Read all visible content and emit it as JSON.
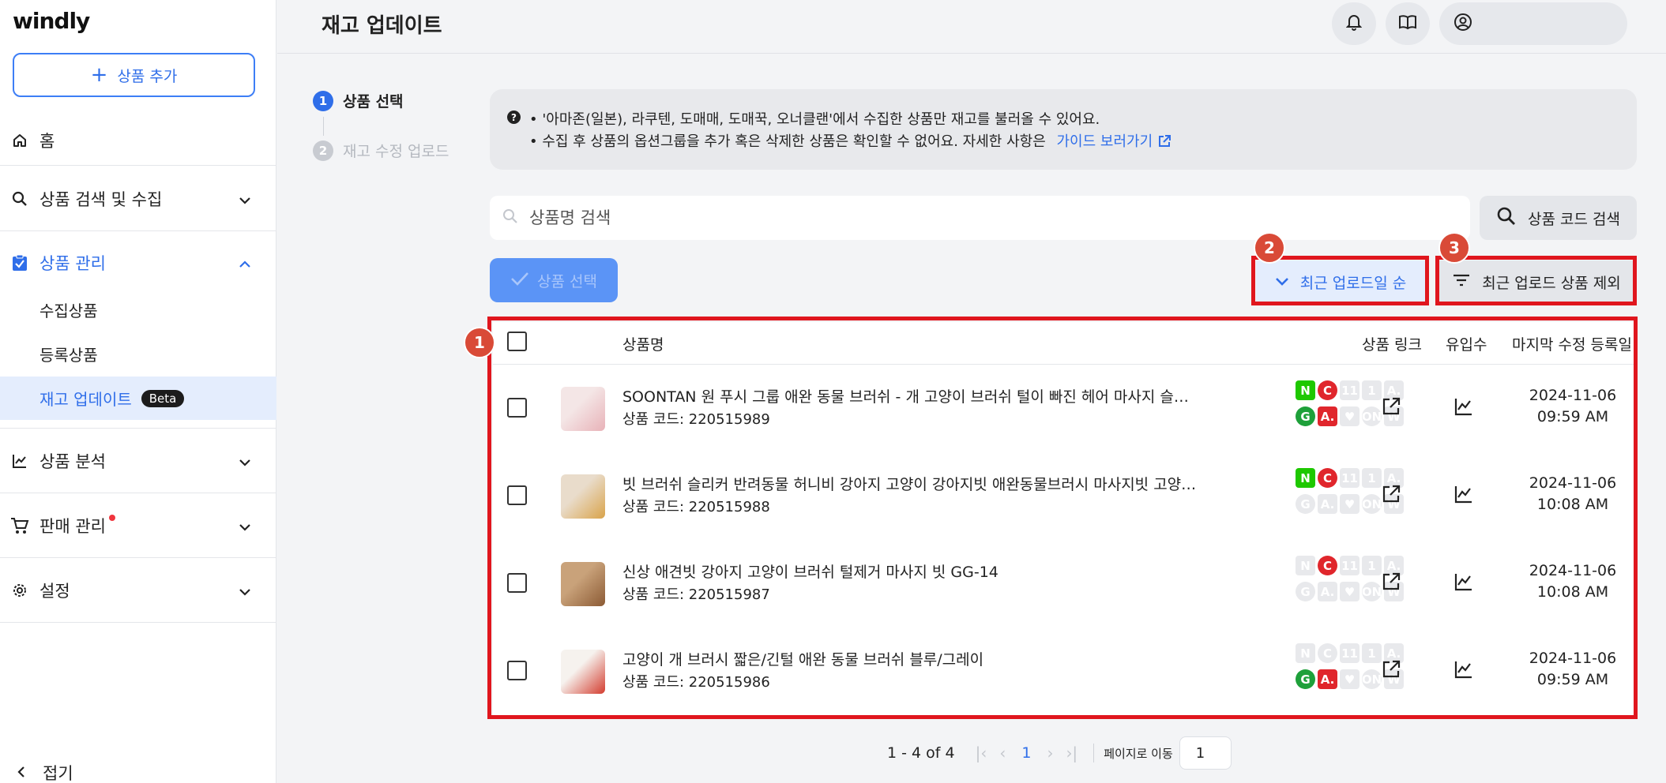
{
  "app": {
    "logo": "windly"
  },
  "sidebar": {
    "add_button": "상품 추가",
    "items": [
      {
        "label": "홈"
      },
      {
        "label": "상품 검색 및 수집"
      },
      {
        "label": "상품 관리"
      },
      {
        "label": "상품 분석"
      },
      {
        "label": "판매 관리"
      },
      {
        "label": "설정"
      }
    ],
    "sub_items": [
      {
        "label": "수집상품"
      },
      {
        "label": "등록상품"
      },
      {
        "label": "재고 업데이트",
        "badge": "Beta"
      }
    ],
    "collapse": "접기"
  },
  "header": {
    "title": "재고 업데이트"
  },
  "steps": [
    {
      "num": "1",
      "label": "상품 선택"
    },
    {
      "num": "2",
      "label": "재고 수정 업로드"
    }
  ],
  "notice": {
    "q": "?",
    "line1": "• '아마존(일본), 라쿠텐, 도매매, 도매꾹, 오너클랜'에서 수집한 상품만 재고를 불러올 수 있어요.",
    "line2": "• 수집 후 상품의 옵션그룹을 추가 혹은 삭제한 상품은 확인할 수 없어요. 자세한 사항은",
    "guide_link": "가이드 보러가기"
  },
  "search": {
    "placeholder": "상품명 검색",
    "code_button": "상품 코드 검색"
  },
  "toolbar": {
    "select_button": "상품 선택",
    "sort_button": "최근 업로드일 순",
    "exclude_button": "최근 업로드 상품 제외"
  },
  "badges": [
    "1",
    "2",
    "3"
  ],
  "table": {
    "columns": [
      "상품명",
      "상품 링크",
      "유입수",
      "마지막 수정 등록일"
    ],
    "rows": [
      {
        "name": "SOONTAN 원 푸시 그룹 애완 동물 브러쉬 - 개 고양이 브러쉬 털이 빠진 헤어 마사지 슬리커 빗",
        "code": "상품 코드: 220515989",
        "date": "2024-11-06",
        "time": "09:59 AM",
        "markets": [
          1,
          1,
          0,
          0,
          0,
          1,
          1,
          0,
          0,
          0
        ]
      },
      {
        "name": "빗 브러쉬 슬리커 반려동물 허니비 강아지 고양이 강아지빗 애완동물브러시 마사지빗 고양이빗",
        "code": "상품 코드: 220515988",
        "date": "2024-11-06",
        "time": "10:08 AM",
        "markets": [
          1,
          1,
          0,
          0,
          0,
          0,
          0,
          0,
          0,
          0
        ]
      },
      {
        "name": "신상 애견빗 강아지 고양이 브러쉬 털제거 마사지 빗 GG-14",
        "code": "상품 코드: 220515987",
        "date": "2024-11-06",
        "time": "10:08 AM",
        "markets": [
          0,
          1,
          0,
          0,
          0,
          0,
          0,
          0,
          0,
          0
        ]
      },
      {
        "name": "고양이 개 브러시 짧은/긴털 애완 동물 브러쉬 블루/그레이",
        "code": "상품 코드: 220515986",
        "date": "2024-11-06",
        "time": "09:59 AM",
        "markets": [
          0,
          0,
          0,
          0,
          0,
          1,
          1,
          0,
          0,
          0
        ]
      }
    ]
  },
  "market_icons": {
    "top": [
      {
        "name": "naver-market-icon",
        "glyph": "N",
        "color": "#1ec800"
      },
      {
        "name": "coupang-market-icon",
        "glyph": "C",
        "color": "#e0262c"
      },
      {
        "name": "11st-market-icon",
        "glyph": "11",
        "color": "#e8e9ec"
      },
      {
        "name": "lotteon-market-icon",
        "glyph": "1",
        "color": "#e8e9ec"
      },
      {
        "name": "auction-market-icon",
        "glyph": "A.",
        "color": "#e8e9ec"
      }
    ],
    "bottom": [
      {
        "name": "gmarket-market-icon",
        "glyph": "G",
        "color": "#1ea03a"
      },
      {
        "name": "auction-red-market-icon",
        "glyph": "A.",
        "color": "#e0262c"
      },
      {
        "name": "heart-market-icon",
        "glyph": "♥",
        "color": "#e8e9ec"
      },
      {
        "name": "on-market-icon",
        "glyph": "ON",
        "color": "#e8e9ec"
      },
      {
        "name": "wemakeprice-market-icon",
        "glyph": "W",
        "color": "#e8e9ec"
      }
    ]
  },
  "pagination": {
    "range": "1 - 4 of 4",
    "current": "1",
    "goto_label": "페이지로 이동",
    "goto_value": "1"
  },
  "colors": {
    "accent": "#2f6ee9",
    "highlight": "#e0161e",
    "badge": "#d94a37"
  }
}
